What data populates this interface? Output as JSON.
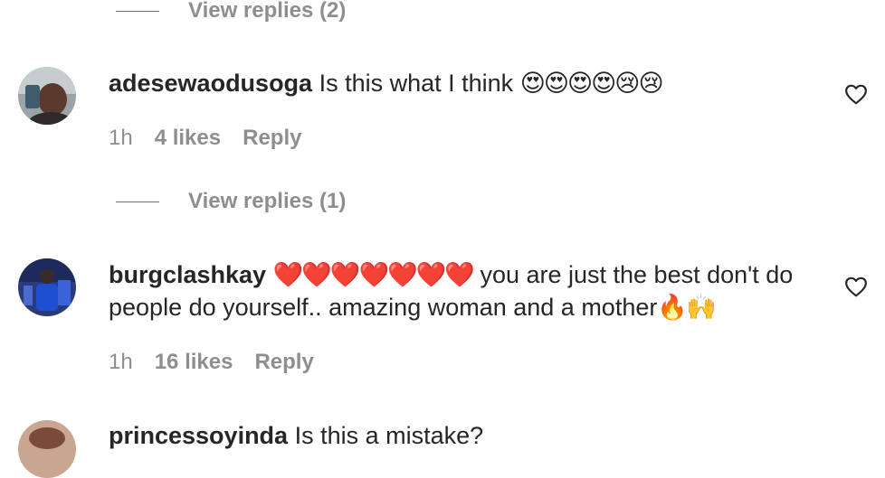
{
  "thread_top": {
    "view_replies": "View replies (2)"
  },
  "comments": [
    {
      "username": "adesewaodusoga",
      "text": "Is this what I think",
      "emojis": "😍😍😍😍😢😢",
      "time": "1h",
      "likes": "4 likes",
      "reply": "Reply",
      "view_replies": "View replies (1)"
    },
    {
      "username": "burgclashkay",
      "hearts": "❤️❤️❤️❤️❤️❤️❤️",
      "text": "you are just the best don't do people do yourself.. amazing woman and a mother",
      "emojis": "🔥🙌",
      "time": "1h",
      "likes": "16 likes",
      "reply": "Reply"
    },
    {
      "username": "princessoyinda",
      "text": "Is this a mistake?"
    }
  ],
  "colors": {
    "text": "#262626",
    "muted": "#8e8e8e"
  },
  "icons": {
    "like": "heart-outline-icon"
  }
}
